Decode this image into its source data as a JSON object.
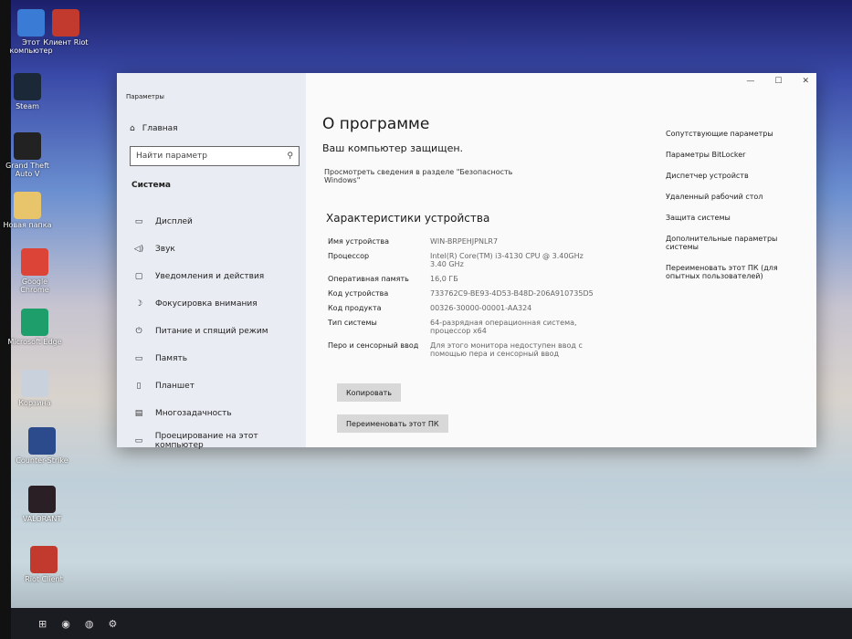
{
  "desktop": {
    "icons": [
      {
        "label": "Этот компьютер",
        "color": "#3a7bd5"
      },
      {
        "label": "Клиент Riot",
        "color": "#c23a2d"
      },
      {
        "label": "Steam",
        "color": "#1b2838"
      },
      {
        "label": "Grand Theft Auto V",
        "color": "#222"
      },
      {
        "label": "Новая папка",
        "color": "#e8c56a"
      },
      {
        "label": "Google Chrome",
        "color": "#db4437"
      },
      {
        "label": "Microsoft Edge",
        "color": "#1e9e6a"
      },
      {
        "label": "Корзина",
        "color": "#c9d2dc"
      },
      {
        "label": "Counter-Strike",
        "color": "#2b4b8c"
      },
      {
        "label": "VALORANT",
        "color": "#2a1f24"
      },
      {
        "label": "Riot Client",
        "color": "#c23a2d"
      }
    ]
  },
  "window": {
    "title": "Параметры",
    "controls": [
      "—",
      "☐",
      "✕"
    ]
  },
  "sidebar": {
    "home": "Главная",
    "search_placeholder": "Найти параметр",
    "section": "Система",
    "items": [
      {
        "icon": "▭",
        "label": "Дисплей"
      },
      {
        "icon": "◁)",
        "label": "Звук"
      },
      {
        "icon": "▢",
        "label": "Уведомления и действия"
      },
      {
        "icon": "☽",
        "label": "Фокусировка внимания"
      },
      {
        "icon": "⏻",
        "label": "Питание и спящий режим"
      },
      {
        "icon": "▭",
        "label": "Память"
      },
      {
        "icon": "▯",
        "label": "Планшет"
      },
      {
        "icon": "▤",
        "label": "Многозадачность"
      },
      {
        "icon": "▭",
        "label": "Проецирование на этот компьютер"
      }
    ]
  },
  "main": {
    "title": "О программе",
    "protected": "Ваш компьютер защищен.",
    "security_link": "Просмотреть сведения в разделе \"Безопасность Windows\"",
    "specs_title": "Характеристики устройства",
    "specs": [
      {
        "k": "Имя устройства",
        "v": "WIN-BRPEHJPNLR7"
      },
      {
        "k": "Процессор",
        "v": "Intel(R) Core(TM) i3-4130 CPU @ 3.40GHz 3.40 GHz"
      },
      {
        "k": "Оперативная память",
        "v": "16,0 ГБ"
      },
      {
        "k": "Код устройства",
        "v": "733762C9-BE93-4D53-B48D-206A910735D5"
      },
      {
        "k": "Код продукта",
        "v": "00326-30000-00001-AA324"
      },
      {
        "k": "Тип системы",
        "v": "64-разрядная операционная система, процессор x64"
      },
      {
        "k": "Перо и сенсорный ввод",
        "v": "Для этого монитора недоступен ввод с помощью пера и сенсорный ввод"
      }
    ],
    "copy_button": "Копировать",
    "rename_button": "Переименовать этот ПК"
  },
  "related": {
    "title": "Сопутствующие параметры",
    "links": [
      "Параметры BitLocker",
      "Диспетчер устройств",
      "Удаленный рабочий стол",
      "Защита системы",
      "Дополнительные параметры системы",
      "Переименовать этот ПК (для опытных пользователей)"
    ]
  },
  "taskbar": {
    "items": [
      "⊞",
      "◉",
      "◍",
      "⚙"
    ]
  }
}
